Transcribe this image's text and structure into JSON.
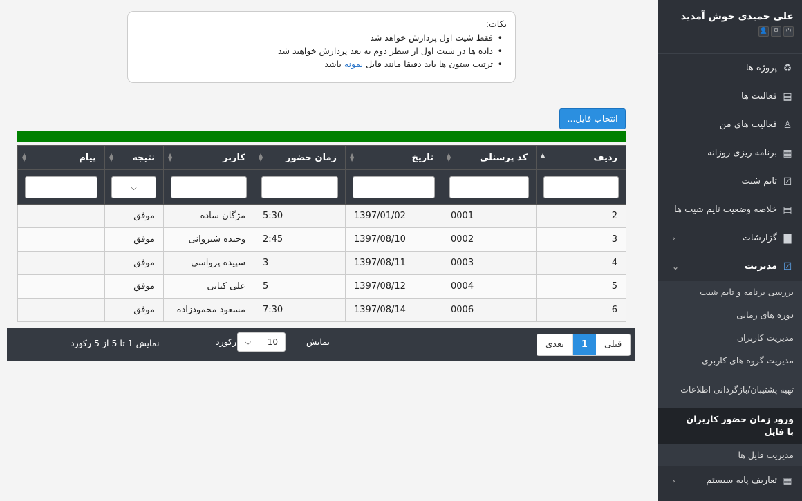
{
  "sidebar": {
    "welcome": "علی حمیدی خوش آمدید",
    "head_icons": [
      "⏻",
      "⚙",
      "👤"
    ],
    "items": [
      {
        "label": "پروژه ها",
        "icon": "♻"
      },
      {
        "label": "فعالیت ها",
        "icon": "▤"
      },
      {
        "label": "فعالیت های من",
        "icon": "♙"
      },
      {
        "label": "برنامه ریزی روزانه",
        "icon": "▦"
      },
      {
        "label": "تایم شیت",
        "icon": "☑"
      },
      {
        "label": "خلاصه وضعیت تایم شیت ها",
        "icon": "▤"
      },
      {
        "label": "گزارشات",
        "icon": "▇",
        "chevron": "‹"
      },
      {
        "label": "مدیریت",
        "icon": "☑",
        "chevron": "⌄"
      }
    ],
    "sub_items": [
      "بررسی برنامه و تایم شیت",
      "دوره های زمانی",
      "مدیریت کاربران",
      "مدیریت گروه های کاربری",
      "تهیه پشتیبان/بازگردانی اطلاعات",
      "ورود زمان حضور کاربران با فایل",
      "مدیریت فایل ها"
    ],
    "last_item": {
      "label": "تعاریف پایه سیستم",
      "icon": "▦",
      "chevron": "‹"
    }
  },
  "notes": {
    "title": "نکات:",
    "line1": "فقط شیت اول پردازش خواهد شد",
    "line2": "داده ها در شیت اول از سطر دوم به بعد پردازش خواهند شد",
    "line3_pre": "ترتیب ستون ها باید دقیقا مانند فایل",
    "line3_link": "نمونه",
    "line3_post": "باشد"
  },
  "file_button": "انتخاب فایل...",
  "progress": 1.0,
  "table": {
    "headers": [
      "ردیف",
      "کد پرسنلی",
      "تاریخ",
      "زمان حضور",
      "کاربر",
      "نتیجه",
      "پیام"
    ],
    "select_icon": "⌵",
    "rows": [
      [
        "2",
        "0001",
        "1397/01/02",
        "5:30",
        "مژگان ساده",
        "موفق",
        ""
      ],
      [
        "3",
        "0002",
        "1397/08/10",
        "2:45",
        "وحیده شیروانی",
        "موفق",
        ""
      ],
      [
        "4",
        "0003",
        "1397/08/11",
        "3",
        "سپیده پرواسی",
        "موفق",
        ""
      ],
      [
        "5",
        "0004",
        "1397/08/12",
        "5",
        "علی کیایی",
        "موفق",
        ""
      ],
      [
        "6",
        "0006",
        "1397/08/14",
        "7:30",
        "مسعود محمودزاده",
        "موفق",
        ""
      ]
    ]
  },
  "footer": {
    "prev": "قبلی",
    "page": "1",
    "next": "بعدی",
    "show": "نمایش",
    "page_size": "10",
    "records": "رکورد",
    "summary": "نمایش 1 تا 5 از 5 رکورد"
  }
}
